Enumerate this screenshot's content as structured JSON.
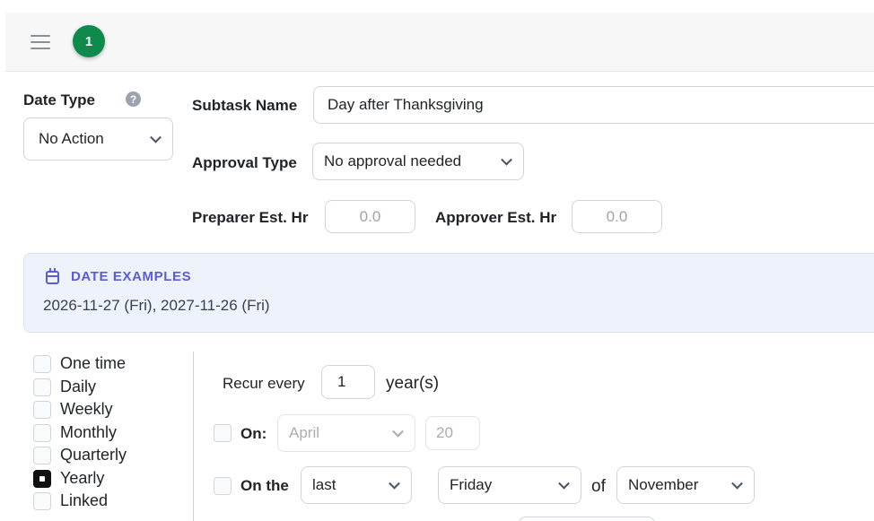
{
  "header": {
    "badge_count": "1"
  },
  "date_type": {
    "label": "Date Type",
    "help": "?",
    "value": "No Action"
  },
  "subtask": {
    "label": "Subtask Name",
    "value": "Day after Thanksgiving"
  },
  "approval": {
    "label": "Approval Type",
    "value": "No approval needed"
  },
  "hours": {
    "preparer_label": "Preparer Est. Hr",
    "preparer_placeholder": "0.0",
    "approver_label": "Approver Est. Hr",
    "approver_placeholder": "0.0"
  },
  "date_examples": {
    "title": "DATE EXAMPLES",
    "text": "2026-11-27 (Fri), 2027-11-26 (Fri)"
  },
  "frequency": {
    "options": [
      "One time",
      "Daily",
      "Weekly",
      "Monthly",
      "Quarterly",
      "Yearly",
      "Linked"
    ],
    "selected": "Yearly"
  },
  "recurrence": {
    "recur_label": "Recur every",
    "recur_value": "1",
    "recur_unit": "year(s)",
    "on_label": "On:",
    "on_month": "April",
    "on_day": "20",
    "on_the_label": "On the",
    "on_the_ordinal": "last",
    "on_the_weekday": "Friday",
    "of_label": "of",
    "on_the_month": "November"
  },
  "colors": {
    "accent": "#5b5bd6",
    "badge": "#0f8a4d",
    "panel_bg": "#eef3fb"
  }
}
